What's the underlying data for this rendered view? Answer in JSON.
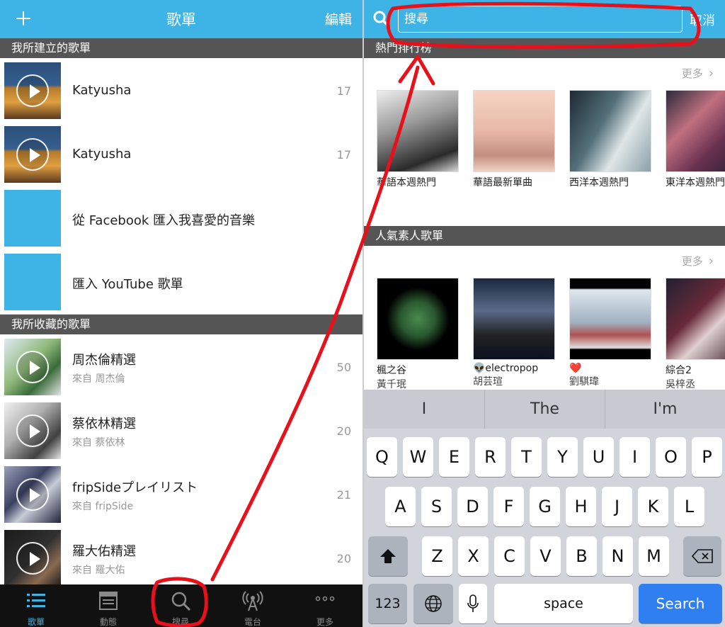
{
  "left": {
    "header": {
      "title": "歌單",
      "add_icon": "plus-icon",
      "edit_label": "編輯"
    },
    "sections": {
      "created": "我所建立的歌單",
      "saved": "我所收藏的歌單"
    },
    "created_playlists": [
      {
        "name": "Katyusha",
        "count": "17"
      },
      {
        "name": "Katyusha",
        "count": "17"
      },
      {
        "name": "從 Facebook 匯入我喜愛的音樂"
      },
      {
        "name": "匯入 YouTube 歌單"
      }
    ],
    "saved_playlists": [
      {
        "name": "周杰倫精選",
        "source": "來自 周杰倫",
        "count": "50"
      },
      {
        "name": "蔡依林精選",
        "source": "來自 蔡依林",
        "count": "20"
      },
      {
        "name": "fripSideプレイリスト",
        "source": "來自 fripSide",
        "count": "21"
      },
      {
        "name": "羅大佑精選",
        "source": "來自 羅大佑",
        "count": "20"
      }
    ],
    "tabbar": [
      {
        "label": "歌單",
        "icon": "list-icon",
        "active": true
      },
      {
        "label": "動態",
        "icon": "feed-icon"
      },
      {
        "label": "搜尋",
        "icon": "search-icon"
      },
      {
        "label": "電台",
        "icon": "radio-icon"
      },
      {
        "label": "更多",
        "icon": "more-icon"
      }
    ]
  },
  "right": {
    "search": {
      "placeholder": "搜尋",
      "cancel_label": "取消"
    },
    "hot_section": {
      "title": "熱門排行榜",
      "more_label": "更多"
    },
    "hot_cards": [
      {
        "caption": "華語本週熱門"
      },
      {
        "caption": "華語最新單曲"
      },
      {
        "caption": "西洋本週熱門"
      },
      {
        "caption": "東洋本週熱門"
      }
    ],
    "popular_section": {
      "title": "人氣素人歌單",
      "more_label": "更多"
    },
    "popular_cards": [
      {
        "title": "楓之谷",
        "author": "黃千珉"
      },
      {
        "title": "👽electropop",
        "author": "胡芸瑄"
      },
      {
        "title": "❤️",
        "author": "劉騏瑋"
      },
      {
        "title": "綜合2",
        "author": "吳梓丞"
      }
    ],
    "keyboard": {
      "suggestions": [
        "I",
        "The",
        "I'm"
      ],
      "row1": [
        "Q",
        "W",
        "E",
        "R",
        "T",
        "Y",
        "U",
        "I",
        "O",
        "P"
      ],
      "row2": [
        "A",
        "S",
        "D",
        "F",
        "G",
        "H",
        "J",
        "K",
        "L"
      ],
      "row3": [
        "Z",
        "X",
        "C",
        "V",
        "B",
        "N",
        "M"
      ],
      "numbers_label": "123",
      "space_label": "space",
      "search_label": "Search"
    }
  },
  "colors": {
    "accent": "#3eb3e6",
    "section_bg": "#555555",
    "annotation": "#e8101a"
  }
}
